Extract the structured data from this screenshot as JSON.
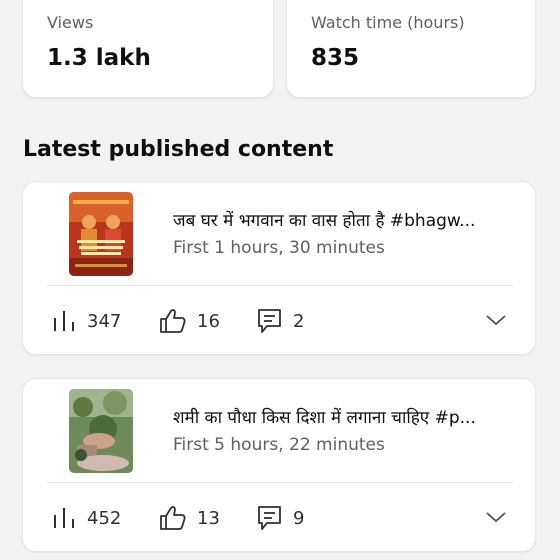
{
  "stats": {
    "views": {
      "label": "Views",
      "value": "1.3 lakh"
    },
    "watch_time": {
      "label": "Watch time (hours)",
      "value": "835"
    }
  },
  "section_title": "Latest published content",
  "content": [
    {
      "title": "जब घर में भगवान का वास होता है #bhagw...",
      "subtitle": "First 1 hours, 30 minutes",
      "views": "347",
      "likes": "16",
      "comments": "2"
    },
    {
      "title": "शमी का पौधा किस दिशा में लगाना चाहिए #p...",
      "subtitle": "First 5 hours, 22 minutes",
      "views": "452",
      "likes": "13",
      "comments": "9"
    }
  ],
  "icons": {
    "views": "bar-chart-icon",
    "likes": "thumbs-up-icon",
    "comments": "comment-icon",
    "expand": "chevron-down-icon"
  },
  "colors": {
    "background": "#f2f2f2",
    "card": "#ffffff",
    "text_primary": "#0f0f0f",
    "text_secondary": "#606060"
  }
}
